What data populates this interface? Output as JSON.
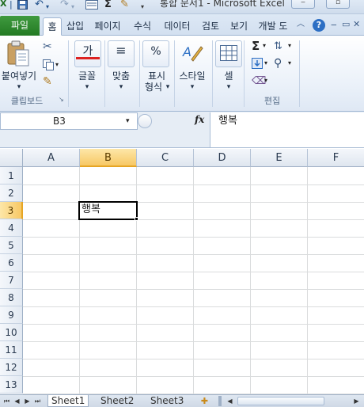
{
  "window": {
    "title": "통합 문서1 - Microsoft Excel",
    "quick_access": [
      "save-icon",
      "undo-icon",
      "redo-icon",
      "form-icon",
      "sum-icon",
      "format-painter-icon",
      "customize-icon"
    ]
  },
  "tabs": {
    "file": "파일",
    "items": [
      "홈",
      "삽입",
      "페이지",
      "수식",
      "데이터",
      "검토",
      "보기",
      "개발 도"
    ],
    "active": "홈"
  },
  "ribbon": {
    "clipboard": {
      "paste_label": "붙여넣기",
      "group_label": "클립보드"
    },
    "font": {
      "label": "글꼴",
      "icon_glyph": "가"
    },
    "alignment": {
      "label": "맞춤",
      "icon_glyph": "≡"
    },
    "number": {
      "label1": "표시",
      "label2": "형식",
      "icon_glyph": "%"
    },
    "styles": {
      "label": "스타일"
    },
    "cells": {
      "label": "셀"
    },
    "editing": {
      "group_label": "편집"
    }
  },
  "formula_bar": {
    "name_box": "B3",
    "fx_label": "fx",
    "content": "행복"
  },
  "grid": {
    "columns": [
      "A",
      "B",
      "C",
      "D",
      "E",
      "F"
    ],
    "rows": [
      "1",
      "2",
      "3",
      "4",
      "5",
      "6",
      "7",
      "8",
      "9",
      "10",
      "11",
      "12",
      "13"
    ],
    "selected_column": "B",
    "selected_row": "3",
    "active_cell": {
      "ref": "B3",
      "value": "행복"
    }
  },
  "sheets": {
    "tabs": [
      "Sheet1",
      "Sheet2",
      "Sheet3"
    ],
    "active": "Sheet1"
  },
  "colors": {
    "file_tab": "#2f8a2f",
    "selection_header": "#f7c865",
    "accent": "#2d6fc4"
  }
}
